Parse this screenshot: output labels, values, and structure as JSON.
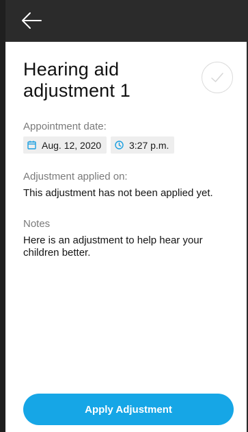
{
  "header": {
    "back_icon": "arrow-left-icon"
  },
  "page": {
    "title": "Hearing aid adjustment 1",
    "status_icon": "check-circle-icon"
  },
  "appointment": {
    "label": "Appointment date:",
    "date": "Aug. 12, 2020",
    "date_icon": "calendar-icon",
    "time": "3:27 p.m.",
    "time_icon": "clock-icon"
  },
  "adjustment_applied": {
    "label": "Adjustment applied on:",
    "value": "This adjustment has not been applied yet."
  },
  "notes": {
    "label": "Notes",
    "value": "Here is an adjustment to help hear your children better."
  },
  "actions": {
    "apply_label": "Apply Adjustment"
  },
  "colors": {
    "app_bar": "#2b2b2b",
    "accent": "#16a6e6",
    "chip_background": "#eeeeee",
    "secondary_text": "#7a7a7a"
  }
}
